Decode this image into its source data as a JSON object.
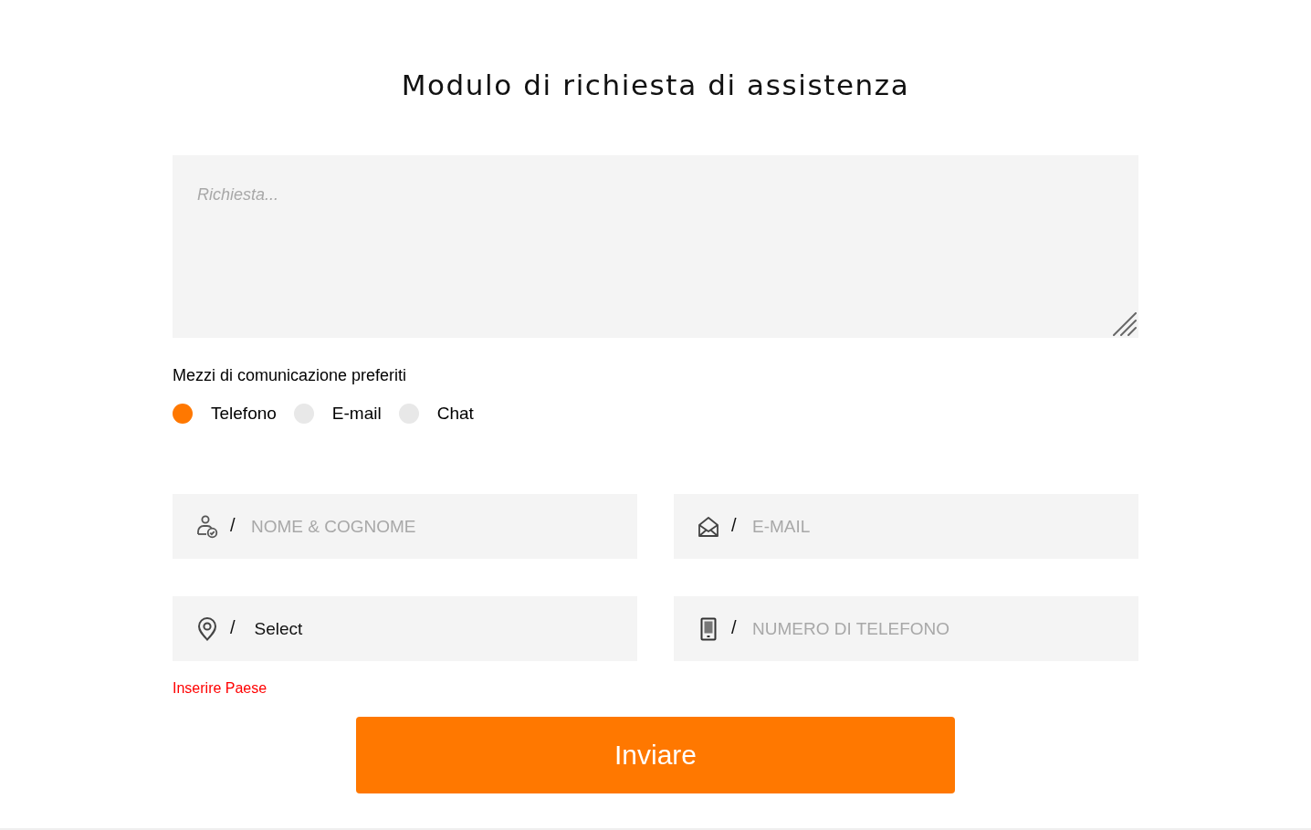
{
  "title": "Modulo di richiesta di assistenza",
  "request": {
    "placeholder": "Richiesta..."
  },
  "contact_methods": {
    "label": "Mezzi di comunicazione preferiti",
    "options": [
      {
        "label": "Telefono",
        "selected": true
      },
      {
        "label": "E-mail",
        "selected": false
      },
      {
        "label": "Chat",
        "selected": false
      }
    ]
  },
  "fields": [
    {
      "kind": "name",
      "separator": "/",
      "placeholder": "NOME & COGNOME"
    },
    {
      "kind": "email",
      "separator": "/",
      "placeholder": "E-MAIL"
    },
    {
      "kind": "country",
      "separator": "/",
      "value": "Select"
    },
    {
      "kind": "phone",
      "separator": "/",
      "placeholder": "NUMERO DI TELEFONO"
    }
  ],
  "error": "Inserire Paese",
  "submit": "Inviare"
}
